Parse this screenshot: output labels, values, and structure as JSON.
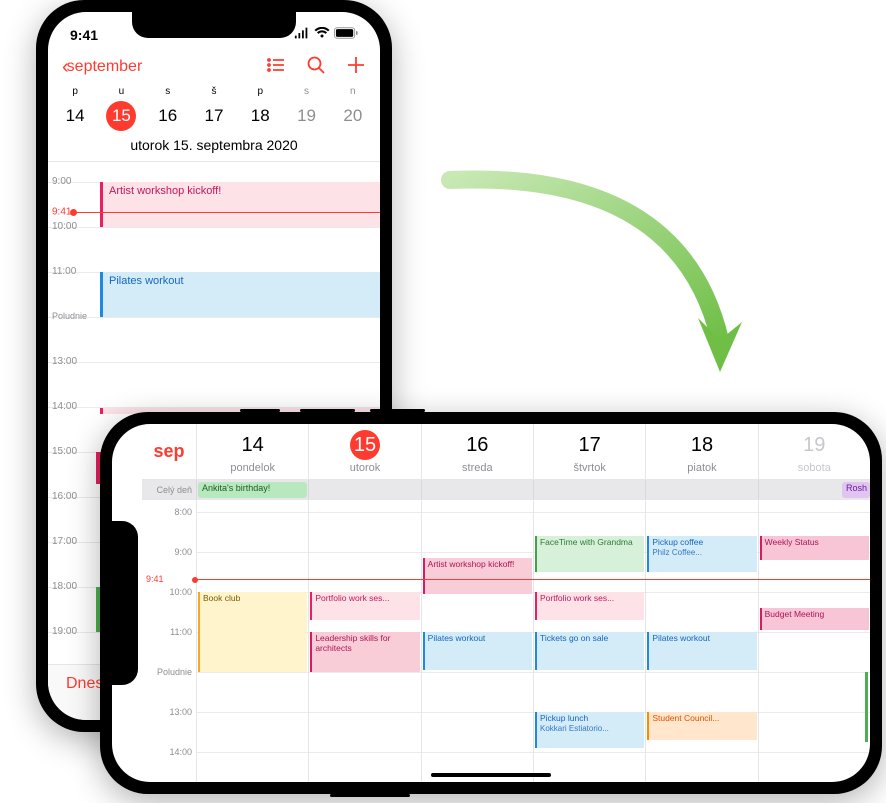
{
  "status": {
    "time": "9:41"
  },
  "portrait": {
    "back_label": "september",
    "weekday_letters": [
      "p",
      "u",
      "s",
      "š",
      "p",
      "s",
      "n"
    ],
    "weekday_numbers": [
      "14",
      "15",
      "16",
      "17",
      "18",
      "19",
      "20"
    ],
    "selected_index": 1,
    "date_title": "utorok  15. septembra 2020",
    "hours": [
      "9:00",
      "10:00",
      "11:00",
      "Poludnie",
      "13:00",
      "14:00",
      "15:00",
      "16:00",
      "17:00",
      "18:00",
      "19:00"
    ],
    "now_label": "9:41",
    "events": {
      "artist": "Artist workshop kickoff!",
      "pilates": "Pilates workout"
    },
    "today_btn": "Dnes"
  },
  "landscape": {
    "month_label": "sep",
    "days": [
      {
        "num": "14",
        "name": "pondelok"
      },
      {
        "num": "15",
        "name": "utorok"
      },
      {
        "num": "16",
        "name": "streda"
      },
      {
        "num": "17",
        "name": "štvrtok"
      },
      {
        "num": "18",
        "name": "piatok"
      },
      {
        "num": "19",
        "name": "sobota"
      }
    ],
    "selected_day_index": 1,
    "allday_label": "Celý deň",
    "allday_events": {
      "ankita": "Ankita's birthday!",
      "rosh": "Rosh"
    },
    "hours": [
      "8:00",
      "9:00",
      "10:00",
      "11:00",
      "Poludnie",
      "13:00",
      "14:00"
    ],
    "now_label": "9:41",
    "events": {
      "bookclub": "Book club",
      "portfolio": "Portfolio work ses...",
      "leadership": "Leadership skills for architects",
      "artist": "Artist workshop kickoff!",
      "pilates": "Pilates workout",
      "facetime": "FaceTime with Grandma",
      "tickets": "Tickets go on sale",
      "pickup_lunch": "Pickup lunch",
      "pickup_lunch_sub": "Kokkari Estiatorio...",
      "pickup_coffee": "Pickup coffee",
      "pickup_coffee_sub": "Philz Coffee...",
      "student": "Student Council...",
      "weekly": "Weekly Status",
      "budget": "Budget Meeting"
    }
  }
}
